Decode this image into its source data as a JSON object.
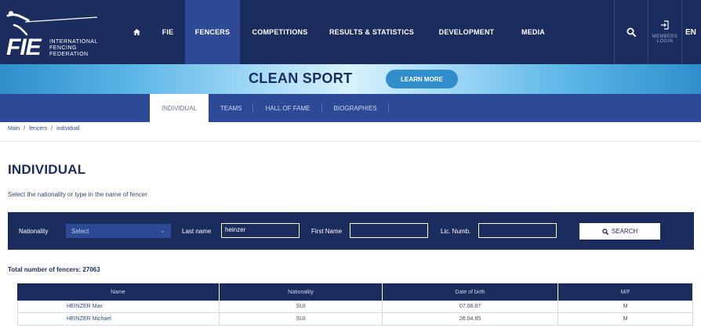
{
  "header": {
    "org_short": "FIE",
    "org_lines": [
      "INTERNATIONAL",
      "FENCING",
      "FEDERATION"
    ],
    "nav": {
      "fie": "FIE",
      "fencers": "FENCERS",
      "competitions": "COMPETITIONS",
      "results": "RESULTS & STATISTICS",
      "development": "DEVELOPMENT",
      "media": "MEDIA"
    },
    "login_line1": "MEMBERS",
    "login_line2": "LOGIN",
    "lang": "EN"
  },
  "banner": {
    "title": "CLEAN SPORT",
    "button": "LEARN MORE"
  },
  "subnav": {
    "tabs": [
      {
        "label": "INDIVIDUAL",
        "active": true
      },
      {
        "label": "TEAMS",
        "active": false
      },
      {
        "label": "HALL OF FAME",
        "active": false
      },
      {
        "label": "BIOGRAPHIES",
        "active": false
      }
    ]
  },
  "breadcrumb": {
    "items": [
      "Main",
      "fencers",
      "individual"
    ],
    "separator": "/"
  },
  "page": {
    "title": "INDIVIDUAL",
    "subtitle": "Select the nationality or type in the name of fencer"
  },
  "search": {
    "nationality_label": "Nationality",
    "nationality_value": "Select",
    "lastname_label": "Last name",
    "lastname_value": "heinzer",
    "firstname_label": "First Name",
    "firstname_value": "",
    "licnum_label": "Lic. Numb.",
    "licnum_value": "",
    "button": "SEARCH"
  },
  "results": {
    "total_label": "Total number of fencers: 27063",
    "columns": [
      "Name",
      "Nationality",
      "Date of birth",
      "M/F"
    ],
    "rows": [
      [
        "HEINZER Max",
        "SUI",
        "07.08.87",
        "M"
      ],
      [
        "HEINZER Michael",
        "SUI",
        "26.04.85",
        "M"
      ]
    ]
  },
  "colors": {
    "navy": "#1b2d5f",
    "royal": "#2d4a97",
    "sky": "#2f8ecb"
  }
}
